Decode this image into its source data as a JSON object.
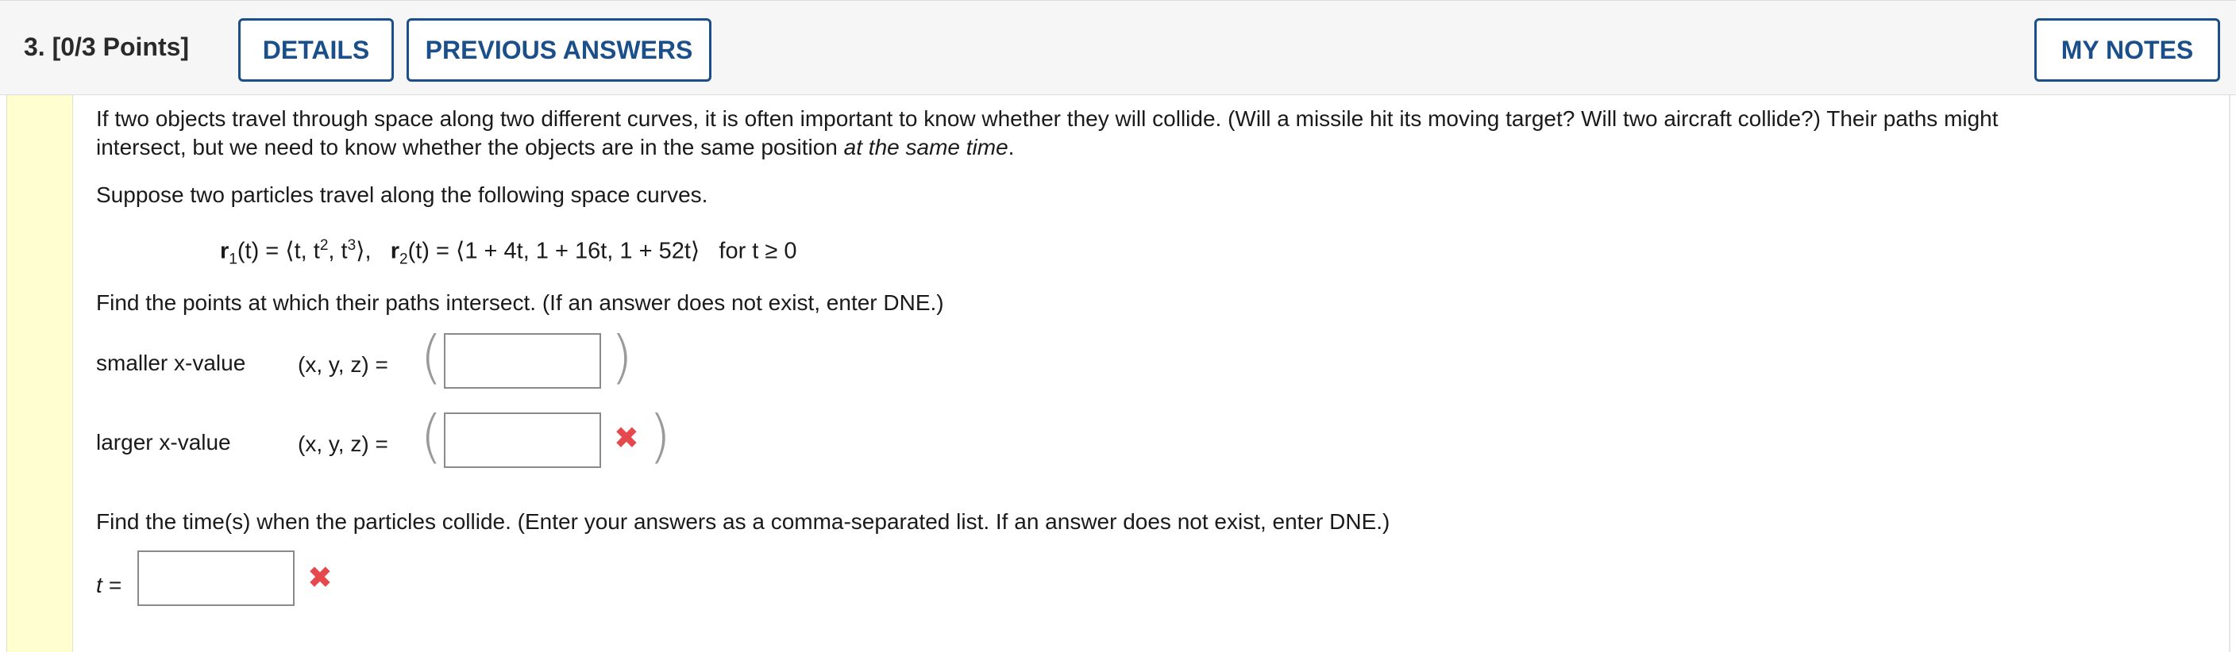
{
  "header": {
    "question_number": "3.",
    "points": "[0/3 Points]",
    "details_label": "DETAILS",
    "previous_answers_label": "PREVIOUS ANSWERS",
    "my_notes_label": "MY NOTES"
  },
  "problem": {
    "intro_line1": "If two objects travel through space along two different curves, it is often important to know whether they will collide. (Will a missile hit its moving target? Will two aircraft collide?) Their paths might",
    "intro_line2_plain": "intersect, but we need to know whether the objects are in the same position ",
    "intro_line2_italic": "at the same time",
    "intro_line2_end": ".",
    "suppose": "Suppose two particles travel along the following space curves.",
    "formula": {
      "r1_name": "r",
      "r1_sub": "1",
      "r1_expr_a": "(t) = ⟨t, t",
      "r1_sup2": "2",
      "r1_expr_b": ", t",
      "r1_sup3": "3",
      "r1_expr_c": "⟩,",
      "r2_name": "r",
      "r2_sub": "2",
      "r2_expr": "(t) = ⟨1 + 4t, 1 + 16t, 1 + 52t⟩",
      "condition": "for t ≥ 0"
    },
    "find_points": "Find the points at which their paths intersect. (If an answer does not exist, enter DNE.)",
    "smaller_label": "smaller x-value",
    "larger_label": "larger x-value",
    "xyz_eq": "(x, y, z)  =",
    "open_paren": "(",
    "close_paren": ")",
    "smaller_value": "",
    "larger_value": "",
    "find_times": "Find the time(s) when the particles collide. (Enter your answers as a comma-separated list. If an answer does not exist, enter DNE.)",
    "t_label": "t =",
    "t_value": ""
  },
  "status": {
    "incorrect_icon": "x-mark-icon",
    "incorrect_color": "#e5484d",
    "accent_color": "#1b4f8a"
  }
}
